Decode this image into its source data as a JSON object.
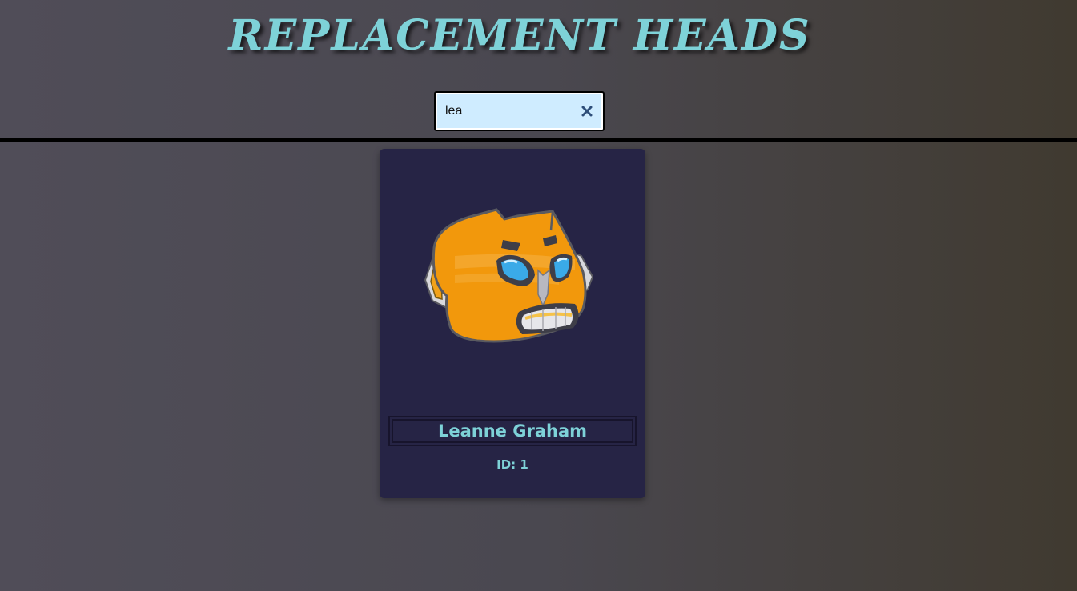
{
  "header": {
    "title": "REPLACEMENT HEADS"
  },
  "search": {
    "value": "lea",
    "clear_icon": "close-icon"
  },
  "results": [
    {
      "name": "Leanne Graham",
      "id_text": "ID: 1",
      "image": "robot-head-avatar"
    }
  ],
  "colors": {
    "accent": "#7ed2d8",
    "card_bg": "#262445",
    "search_bg": "#cfecff",
    "robot_orange": "#f2980c"
  }
}
